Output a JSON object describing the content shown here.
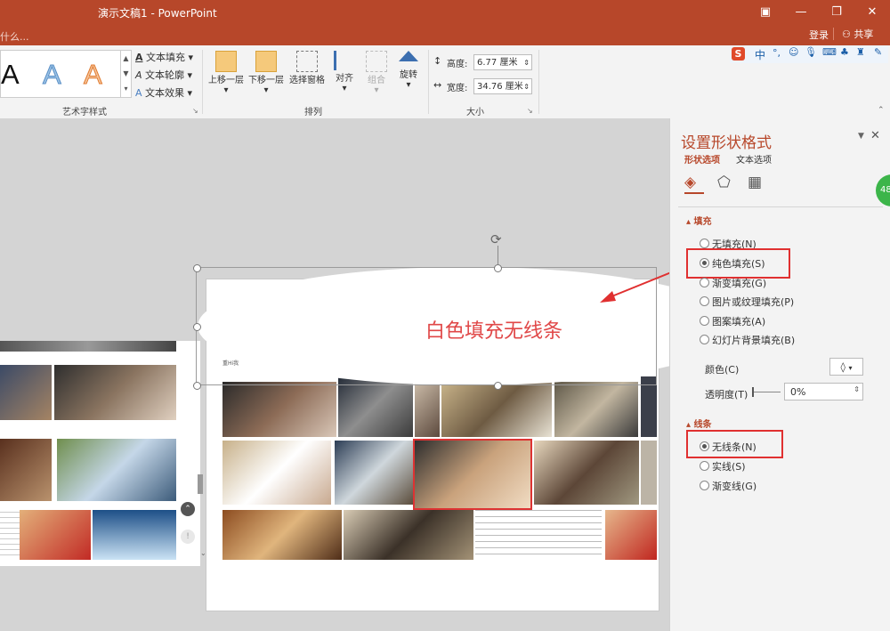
{
  "window": {
    "title": "演示文稿1 - PowerPoint",
    "tell_me": "什么...",
    "login": "登录",
    "share": "共享"
  },
  "ribbon": {
    "wordart_label": "艺术字样式",
    "text_fill": "文本填充",
    "text_outline": "文本轮廓",
    "text_effect": "文本效果",
    "bring_forward": "上移一层",
    "send_backward": "下移一层",
    "selection_pane": "选择窗格",
    "align": "对齐",
    "group": "组合",
    "rotate": "旋转",
    "arrange_label": "排列",
    "height_label": "高度:",
    "height_value": "6.77 厘米",
    "width_label": "宽度:",
    "width_value": "34.76 厘米",
    "size_label": "大小"
  },
  "ime": {
    "lang": "中"
  },
  "slide": {
    "callout": "白色填充无线条",
    "small_text": "重Hi我"
  },
  "pane": {
    "title": "设置形状格式",
    "tab_shape": "形状选项",
    "tab_text": "文本选项",
    "fill_heading": "填充",
    "fill_options": [
      "无填充(N)",
      "纯色填充(S)",
      "渐变填充(G)",
      "图片或纹理填充(P)",
      "图案填充(A)",
      "幻灯片背景填充(B)"
    ],
    "color_label": "颜色(C)",
    "transparency_label": "透明度(T)",
    "transparency_value": "0%",
    "line_heading": "线条",
    "line_options": [
      "无线条(N)",
      "实线(S)",
      "渐变线(G)"
    ],
    "badge": "48"
  },
  "colors": {
    "accent": "#b7472a",
    "callout": "#e04747",
    "highlight": "#e03030"
  }
}
